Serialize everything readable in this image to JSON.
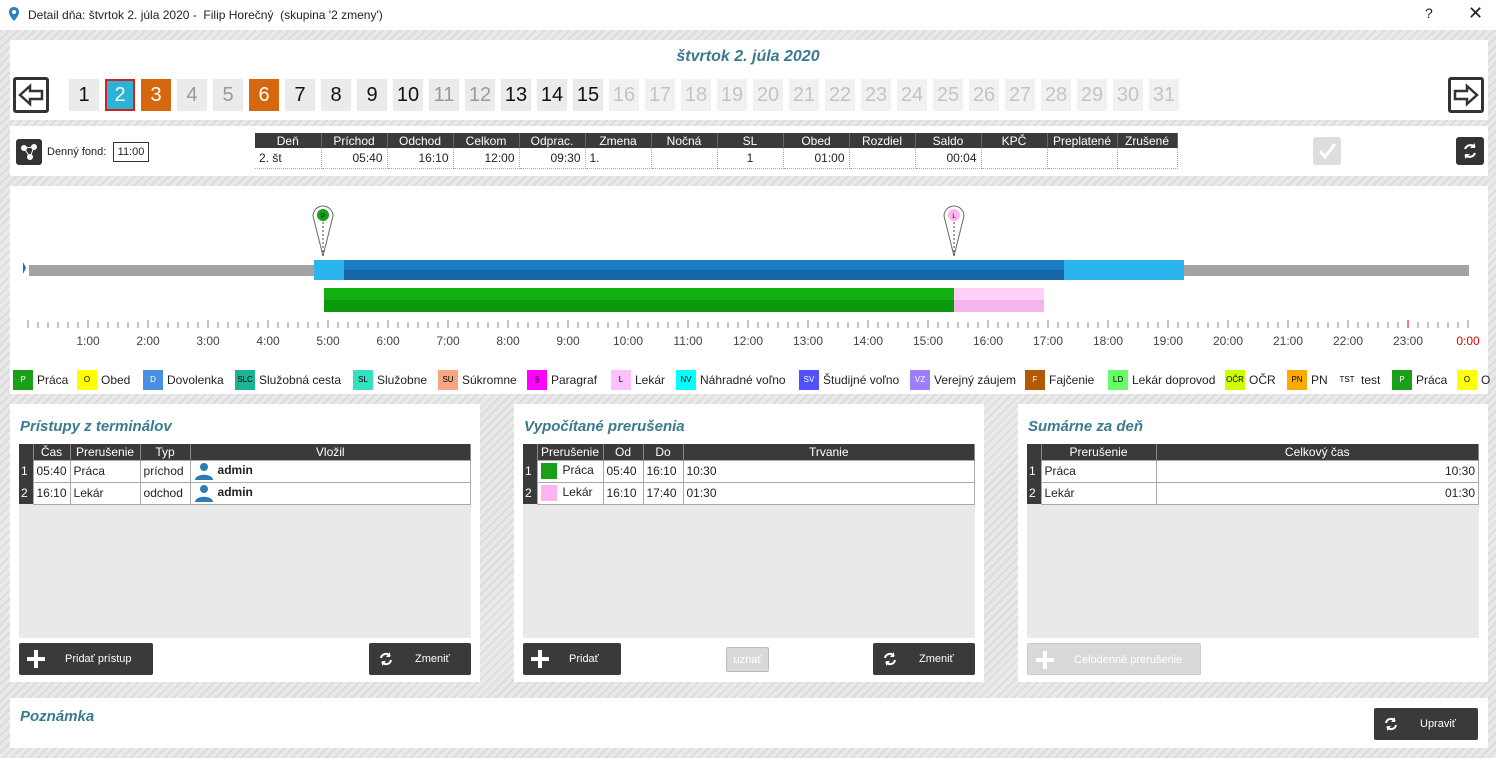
{
  "window": {
    "title": "Detail dňa: štvrtok 2. júla 2020 -  Filip Horečný  (skupina '2 zmeny')",
    "help": "?",
    "close": "✕"
  },
  "day_title": "štvrtok 2. júla 2020",
  "days": [
    "1",
    "2",
    "3",
    "4",
    "5",
    "6",
    "7",
    "8",
    "9",
    "10",
    "11",
    "12",
    "13",
    "14",
    "15",
    "16",
    "17",
    "18",
    "19",
    "20",
    "21",
    "22",
    "23",
    "24",
    "25",
    "26",
    "27",
    "28",
    "29",
    "30",
    "31"
  ],
  "fund": {
    "label": "Denný fond:",
    "value": "11:00"
  },
  "summary": {
    "headers": [
      "Deň",
      "Príchod",
      "Odchod",
      "Celkom",
      "Odprac.",
      "Zmena",
      "Nočná",
      "SL",
      "Obed",
      "Rozdiel",
      "Saldo",
      "KPČ",
      "Preplatené",
      "Zrušené"
    ],
    "row": [
      "2. št",
      "05:40",
      "16:10",
      "12:00",
      "09:30",
      "1.",
      "",
      "1",
      "01:00",
      "",
      "00:04",
      "",
      "",
      ""
    ]
  },
  "timeline": {
    "hours": [
      "1:00",
      "2:00",
      "3:00",
      "4:00",
      "5:00",
      "6:00",
      "7:00",
      "8:00",
      "9:00",
      "10:00",
      "11:00",
      "12:00",
      "13:00",
      "14:00",
      "15:00",
      "16:00",
      "17:00",
      "18:00",
      "19:00",
      "20:00",
      "21:00",
      "22:00",
      "23:00",
      "0:00"
    ],
    "markers": [
      {
        "code": "P",
        "color": "#1aa81a"
      },
      {
        "code": "L",
        "color": "#ffb3f0"
      }
    ]
  },
  "legend": [
    {
      "code": "P",
      "label": "Práca",
      "color": "#19a019",
      "fg": "#fff"
    },
    {
      "code": "O",
      "label": "Obed",
      "color": "#ffff00",
      "fg": "#000"
    },
    {
      "code": "D",
      "label": "Dovolenka",
      "color": "#4a90e2",
      "fg": "#fff"
    },
    {
      "code": "SLC",
      "label": "Služobná cesta",
      "color": "#1ab394",
      "fg": "#000"
    },
    {
      "code": "SL",
      "label": "Služobne",
      "color": "#33e0c0",
      "fg": "#000"
    },
    {
      "code": "SU",
      "label": "Súkromne",
      "color": "#f4a582",
      "fg": "#000"
    },
    {
      "code": "§",
      "label": "Paragraf",
      "color": "#ff00ff",
      "fg": "#000"
    },
    {
      "code": "L",
      "label": "Lekár",
      "color": "#ffc0ff",
      "fg": "#000"
    },
    {
      "code": "NV",
      "label": "Náhradné voľno",
      "color": "#00ffff",
      "fg": "#000"
    },
    {
      "code": "SV",
      "label": "Študijné voľno",
      "color": "#5050ff",
      "fg": "#fff"
    },
    {
      "code": "VZ",
      "label": "Verejný záujem",
      "color": "#9b7fff",
      "fg": "#fff"
    },
    {
      "code": "F",
      "label": "Fajčenie",
      "color": "#b35a00",
      "fg": "#fff"
    },
    {
      "code": "LD",
      "label": "Lekár doprovod",
      "color": "#66ff66",
      "fg": "#000"
    },
    {
      "code": "OČR",
      "label": "OČR",
      "color": "#ccff00",
      "fg": "#000"
    },
    {
      "code": "PN",
      "label": "PN",
      "color": "#ffaa00",
      "fg": "#000"
    },
    {
      "code": "TST",
      "label": "test",
      "color": "#ffffff",
      "fg": "#000"
    },
    {
      "code": "P",
      "label": "Práca",
      "color": "#19a019",
      "fg": "#fff"
    },
    {
      "code": "O",
      "label": "O",
      "color": "#ffff00",
      "fg": "#000"
    }
  ],
  "terminal": {
    "title": "Prístupy z terminálov",
    "headers": [
      "Čas",
      "Prerušenie",
      "Typ",
      "Vložil"
    ],
    "rows": [
      {
        "n": "1",
        "time": "05:40",
        "type": "Práca",
        "dir": "príchod",
        "user": "admin"
      },
      {
        "n": "2",
        "time": "16:10",
        "type": "Lekár",
        "dir": "odchod",
        "user": "admin"
      }
    ],
    "add_label": "Pridať prístup",
    "change_label": "Zmeniť"
  },
  "computed": {
    "title": "Vypočítané prerušenia",
    "headers": [
      "Prerušenie",
      "Od",
      "Do",
      "Trvanie"
    ],
    "rows": [
      {
        "n": "1",
        "name": "Práca",
        "from": "05:40",
        "to": "16:10",
        "dur": "10:30",
        "color": "#19a019"
      },
      {
        "n": "2",
        "name": "Lekár",
        "from": "16:10",
        "to": "17:40",
        "dur": "01:30",
        "color": "#ffb3f0"
      }
    ],
    "add_label": "Pridať",
    "accept_label": "uznať",
    "change_label": "Zmeniť"
  },
  "daysum": {
    "title": "Sumárne za deň",
    "headers": [
      "Prerušenie",
      "Celkový čas"
    ],
    "rows": [
      {
        "n": "1",
        "name": "Práca",
        "total": "10:30"
      },
      {
        "n": "2",
        "name": "Lekár",
        "total": "01:30"
      }
    ],
    "allday_label": "Celodenné prerušenie"
  },
  "note": {
    "title": "Poznámka",
    "edit_label": "Upraviť"
  }
}
